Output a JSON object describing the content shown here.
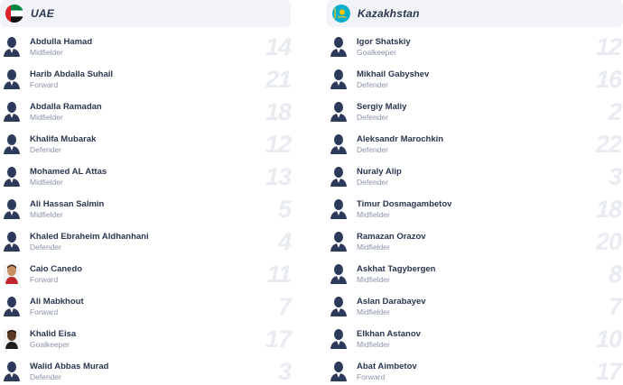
{
  "teams": [
    {
      "name": "UAE",
      "flag_icon": "uae-flag-icon",
      "players": [
        {
          "name": "Abdulla Hamad",
          "position": "Midfielder",
          "number": "14",
          "avatar": "placeholder"
        },
        {
          "name": "Harib Abdalla Suhail",
          "position": "Forward",
          "number": "21",
          "avatar": "placeholder"
        },
        {
          "name": "Abdalla Ramadan",
          "position": "Midfielder",
          "number": "18",
          "avatar": "placeholder"
        },
        {
          "name": "Khalifa Mubarak",
          "position": "Defender",
          "number": "12",
          "avatar": "placeholder"
        },
        {
          "name": "Mohamed AL Attas",
          "position": "Midfielder",
          "number": "13",
          "avatar": "placeholder"
        },
        {
          "name": "Ali Hassan Salmin",
          "position": "Midfielder",
          "number": "5",
          "avatar": "placeholder"
        },
        {
          "name": "Khaled Ebraheim Aldhanhani",
          "position": "Defender",
          "number": "4",
          "avatar": "placeholder"
        },
        {
          "name": "Caio Canedo",
          "position": "Forward",
          "number": "11",
          "avatar": "photo-light"
        },
        {
          "name": "Ali Mabkhout",
          "position": "Forward",
          "number": "7",
          "avatar": "placeholder"
        },
        {
          "name": "Khalid Eisa",
          "position": "Goalkeeper",
          "number": "17",
          "avatar": "photo-dark"
        },
        {
          "name": "Walid Abbas Murad",
          "position": "Defender",
          "number": "3",
          "avatar": "placeholder"
        }
      ]
    },
    {
      "name": "Kazakhstan",
      "flag_icon": "kazakhstan-flag-icon",
      "players": [
        {
          "name": "Igor Shatskiy",
          "position": "Goalkeeper",
          "number": "12",
          "avatar": "placeholder"
        },
        {
          "name": "Mikhail Gabyshev",
          "position": "Defender",
          "number": "16",
          "avatar": "placeholder"
        },
        {
          "name": "Sergiy Maliy",
          "position": "Defender",
          "number": "2",
          "avatar": "placeholder"
        },
        {
          "name": "Aleksandr Marochkin",
          "position": "Defender",
          "number": "22",
          "avatar": "placeholder"
        },
        {
          "name": "Nuraly Alip",
          "position": "Defender",
          "number": "3",
          "avatar": "placeholder"
        },
        {
          "name": "Timur Dosmagambetov",
          "position": "Midfielder",
          "number": "18",
          "avatar": "placeholder"
        },
        {
          "name": "Ramazan Orazov",
          "position": "Midfielder",
          "number": "20",
          "avatar": "placeholder"
        },
        {
          "name": "Askhat Tagybergen",
          "position": "Midfielder",
          "number": "8",
          "avatar": "placeholder"
        },
        {
          "name": "Aslan Darabayev",
          "position": "Midfielder",
          "number": "7",
          "avatar": "placeholder"
        },
        {
          "name": "Elkhan Astanov",
          "position": "Midfielder",
          "number": "10",
          "avatar": "placeholder"
        },
        {
          "name": "Abat Aimbetov",
          "position": "Forward",
          "number": "17",
          "avatar": "placeholder"
        }
      ]
    }
  ],
  "colors": {
    "header_bg": "#f1f3f6",
    "name_text": "#2a3550",
    "position_text": "#8a93a6",
    "jersey_number": "#e8ebf0",
    "avatar_silhouette": "#2c3a5c"
  }
}
